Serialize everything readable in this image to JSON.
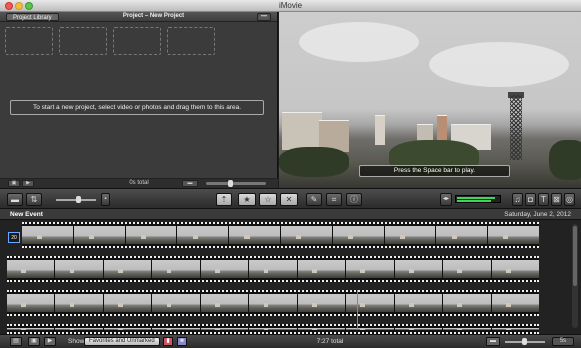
{
  "window": {
    "title": "iMovie"
  },
  "project": {
    "library_button": "Project Library",
    "title": "Project – New Project",
    "options_button": "•••",
    "hint": "To start a new project, select video or photos and drag them to this area.",
    "total": "0s total"
  },
  "viewer": {
    "play_hint": "Press the Space bar to play."
  },
  "toolbar": {
    "icons": [
      "camera-icon",
      "swap-icon",
      "volume-icon",
      "add-to-project-icon",
      "favorite-icon",
      "unmark-icon",
      "reject-icon",
      "voiceover-icon",
      "crop-icon",
      "info-icon",
      "music-icon",
      "photo-icon",
      "title-icon",
      "transition-icon",
      "map-icon"
    ]
  },
  "event": {
    "name": "New Event",
    "date": "Saturday, June 2, 2012",
    "clip_badge": "20"
  },
  "bottom": {
    "show_label": "Show:",
    "filter_value": "Favorites and Unmarked",
    "total": "7:27 total",
    "zoom_label": "5s"
  }
}
